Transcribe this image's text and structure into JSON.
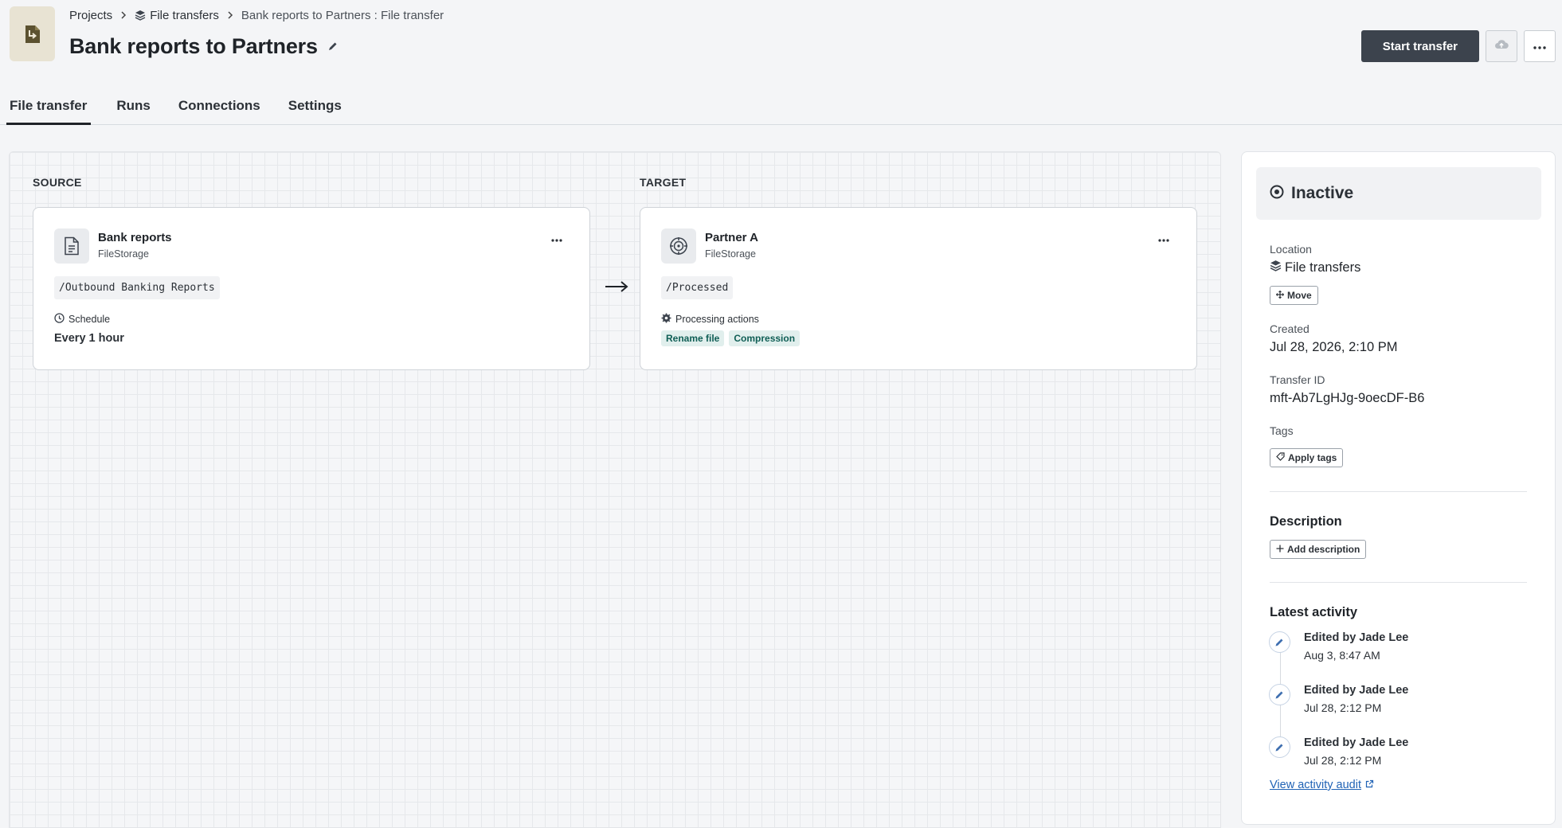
{
  "breadcrumb": {
    "projects": "Projects",
    "file_transfers": "File transfers",
    "current": "Bank reports to Partners : File transfer"
  },
  "page": {
    "title": "Bank reports to Partners"
  },
  "actions": {
    "start_transfer": "Start transfer"
  },
  "tabs": [
    {
      "label": "File transfer",
      "active": true
    },
    {
      "label": "Runs",
      "active": false
    },
    {
      "label": "Connections",
      "active": false
    },
    {
      "label": "Settings",
      "active": false
    }
  ],
  "source": {
    "section_label": "SOURCE",
    "title": "Bank reports",
    "subtitle": "FileStorage",
    "path": "/Outbound Banking Reports",
    "schedule_label": "Schedule",
    "schedule_value": "Every 1 hour",
    "icon": "document-icon"
  },
  "target": {
    "section_label": "TARGET",
    "title": "Partner A",
    "subtitle": "FileStorage",
    "path": "/Processed",
    "processing_label": "Processing actions",
    "processing_actions": [
      "Rename file",
      "Compression"
    ],
    "icon": "target-icon"
  },
  "details": {
    "status": "Inactive",
    "location_label": "Location",
    "location_value": "File transfers",
    "move_button": "Move",
    "created_label": "Created",
    "created_value": "Jul 28, 2026, 2:10 PM",
    "transfer_id_label": "Transfer ID",
    "transfer_id_value": "mft-Ab7LgHJg-9oecDF-B6",
    "tags_label": "Tags",
    "apply_tags_button": "Apply tags",
    "description_heading": "Description",
    "add_description_button": "Add description",
    "activity_heading": "Latest activity",
    "activity": [
      {
        "title": "Edited by Jade Lee",
        "time": "Aug 3, 8:47 AM"
      },
      {
        "title": "Edited by Jade Lee",
        "time": "Jul 28, 2:12 PM"
      },
      {
        "title": "Edited by Jade Lee",
        "time": "Jul 28, 2:12 PM"
      }
    ],
    "view_audit_link": "View activity audit"
  },
  "colors": {
    "primary_button": "#3c434d",
    "chip_bg": "#e1efed",
    "chip_text": "#0f5e55",
    "link": "#1f62b5",
    "app_icon_bg": "#e8e3d3"
  }
}
